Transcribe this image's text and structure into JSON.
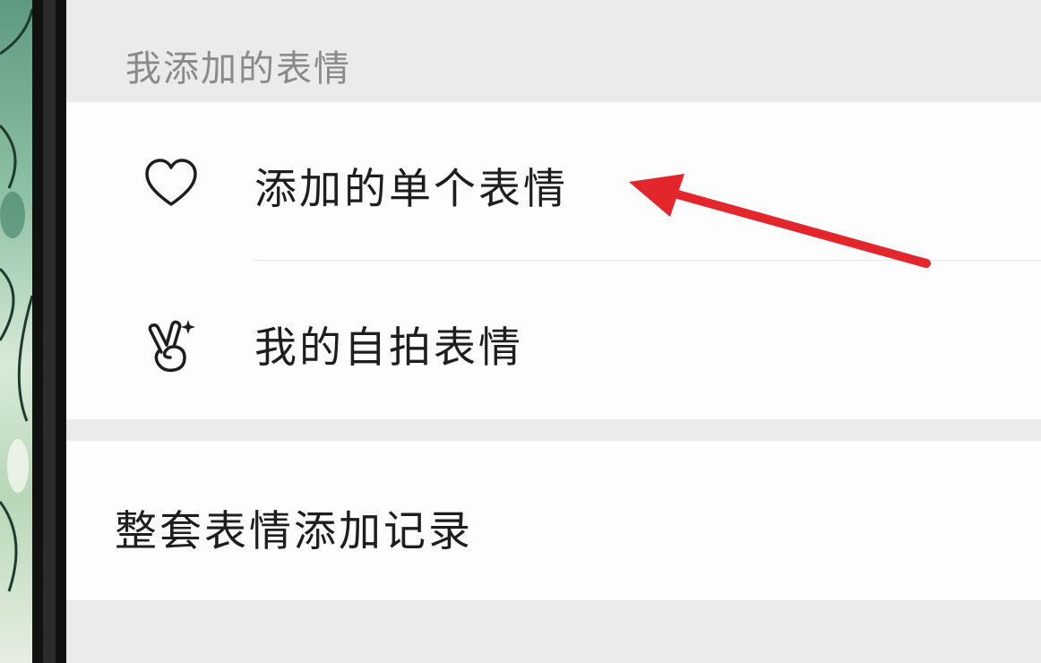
{
  "section": {
    "title": "我添加的表情"
  },
  "items": [
    {
      "label": "添加的单个表情",
      "icon": "heart-icon"
    },
    {
      "label": "我的自拍表情",
      "icon": "victory-hand-sparkle-icon"
    }
  ],
  "record": {
    "label": "整套表情添加记录"
  },
  "colors": {
    "background": "#ebebeb",
    "card": "#fdfdfd",
    "header_text": "#8a8a8a",
    "item_text": "#1e1e1e",
    "arrow": "#e3262b"
  }
}
